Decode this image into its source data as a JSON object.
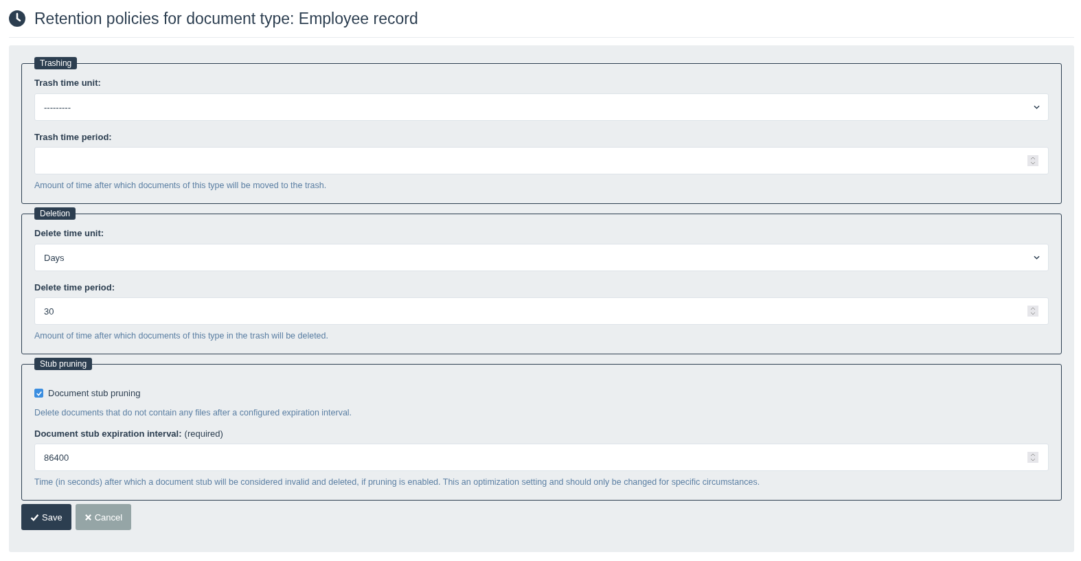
{
  "page": {
    "title": "Retention policies for document type: Employee record"
  },
  "sections": [
    {
      "legend": "Trashing",
      "items": [
        {
          "kind": "select",
          "label": "Trash time unit:",
          "value": "---------"
        },
        {
          "kind": "number",
          "label": "Trash time period:",
          "help": "Amount of time after which documents of this type will be moved to the trash."
        }
      ]
    },
    {
      "legend": "Deletion",
      "items": [
        {
          "kind": "select",
          "label": "Delete time unit:",
          "value": "Days"
        },
        {
          "kind": "number",
          "label": "Delete time period:",
          "value": "30",
          "help": "Amount of time after which documents of this type in the trash will be deleted."
        }
      ]
    },
    {
      "legend": "Stub pruning",
      "items": [
        {
          "kind": "checkbox",
          "label": "Document stub pruning",
          "checked": true,
          "help": "Delete documents that do not contain any files after a configured expiration interval."
        },
        {
          "kind": "number",
          "label": "Document stub expiration interval:",
          "note": "(required)",
          "value": "86400",
          "help": "Time (in seconds) after which a document stub will be considered invalid and deleted, if pruning is enabled. This an optimization setting and should only be changed for specific circumstances."
        }
      ]
    }
  ],
  "buttons": [
    {
      "kind": "primary",
      "label": "Save"
    },
    {
      "kind": "secondary",
      "label": "Cancel"
    }
  ]
}
